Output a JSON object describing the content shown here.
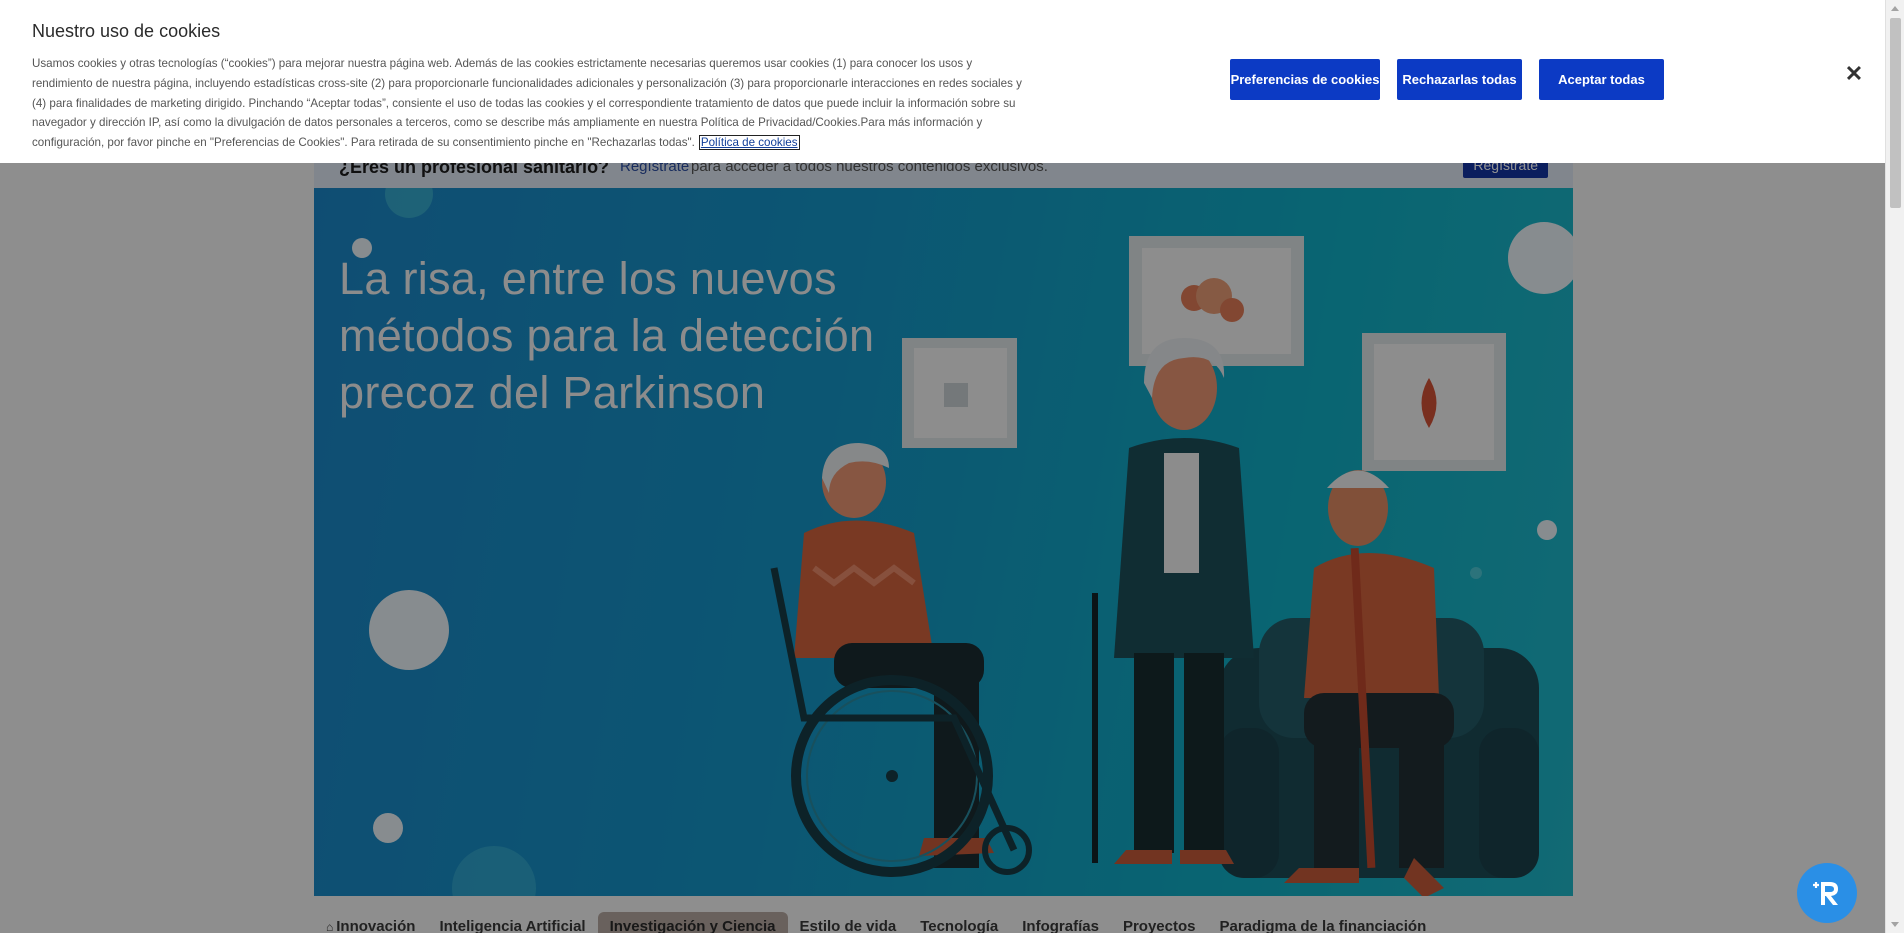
{
  "page": {
    "pro_bar": {
      "question": "¿Eres un profesional sanitario?",
      "link": "Regístrate",
      "rest": "para acceder a todos nuestros contenidos exclusivos.",
      "button": "Regístrate"
    },
    "hero": {
      "title": "La risa, entre los nuevos métodos para la detección precoz del Parkinson"
    },
    "tabs": [
      {
        "label": "Innovación",
        "icon": "home-icon"
      },
      {
        "label": "Inteligencia Artificial"
      },
      {
        "label": "Investigación y Ciencia",
        "active": true
      },
      {
        "label": "Estilo de vida"
      },
      {
        "label": "Tecnología"
      },
      {
        "label": "Infografías"
      },
      {
        "label": "Proyectos"
      },
      {
        "label": "Paradigma de la financiación"
      }
    ]
  },
  "cookie_banner": {
    "title": "Nuestro uso de cookies",
    "text": "Usamos cookies y otras tecnologías (“cookies”) para mejorar nuestra página web. Además de las cookies estrictamente necesarias queremos usar cookies (1) para conocer los usos y rendimiento de nuestra página, incluyendo estadísticas cross-site (2) para proporcionarle funcionalidades adicionales y personalización (3) para proporcionarle interacciones en redes sociales y (4) para finalidades de marketing dirigido. Pinchando “Aceptar todas”, consiente el uso de todas las cookies y el correspondiente tratamiento de datos que puede incluir la información sobre su navegador y dirección IP, así como la divulgación de datos personales a terceros, como se describe más ampliamente en nuestra Política de Privacidad/Cookies.Para más información y configuración, por favor pinche en \"Preferencias de Cookies\". Para retirada de su consentimiento pinche en \"Rechazarlas todas\".",
    "policy_link": "Política de cookies",
    "buttons": {
      "preferences": "Preferencias de cookies",
      "reject": "Rechazarlas todas",
      "accept": "Aceptar todas"
    },
    "close_icon": "close-icon"
  },
  "floating_button": {
    "icon": "add-user-icon"
  },
  "colors": {
    "button_blue": "#0c3ac4",
    "hero_blue": "#1595c6",
    "hero_teal": "#10aec4",
    "fab_blue": "#2a8fe6"
  }
}
